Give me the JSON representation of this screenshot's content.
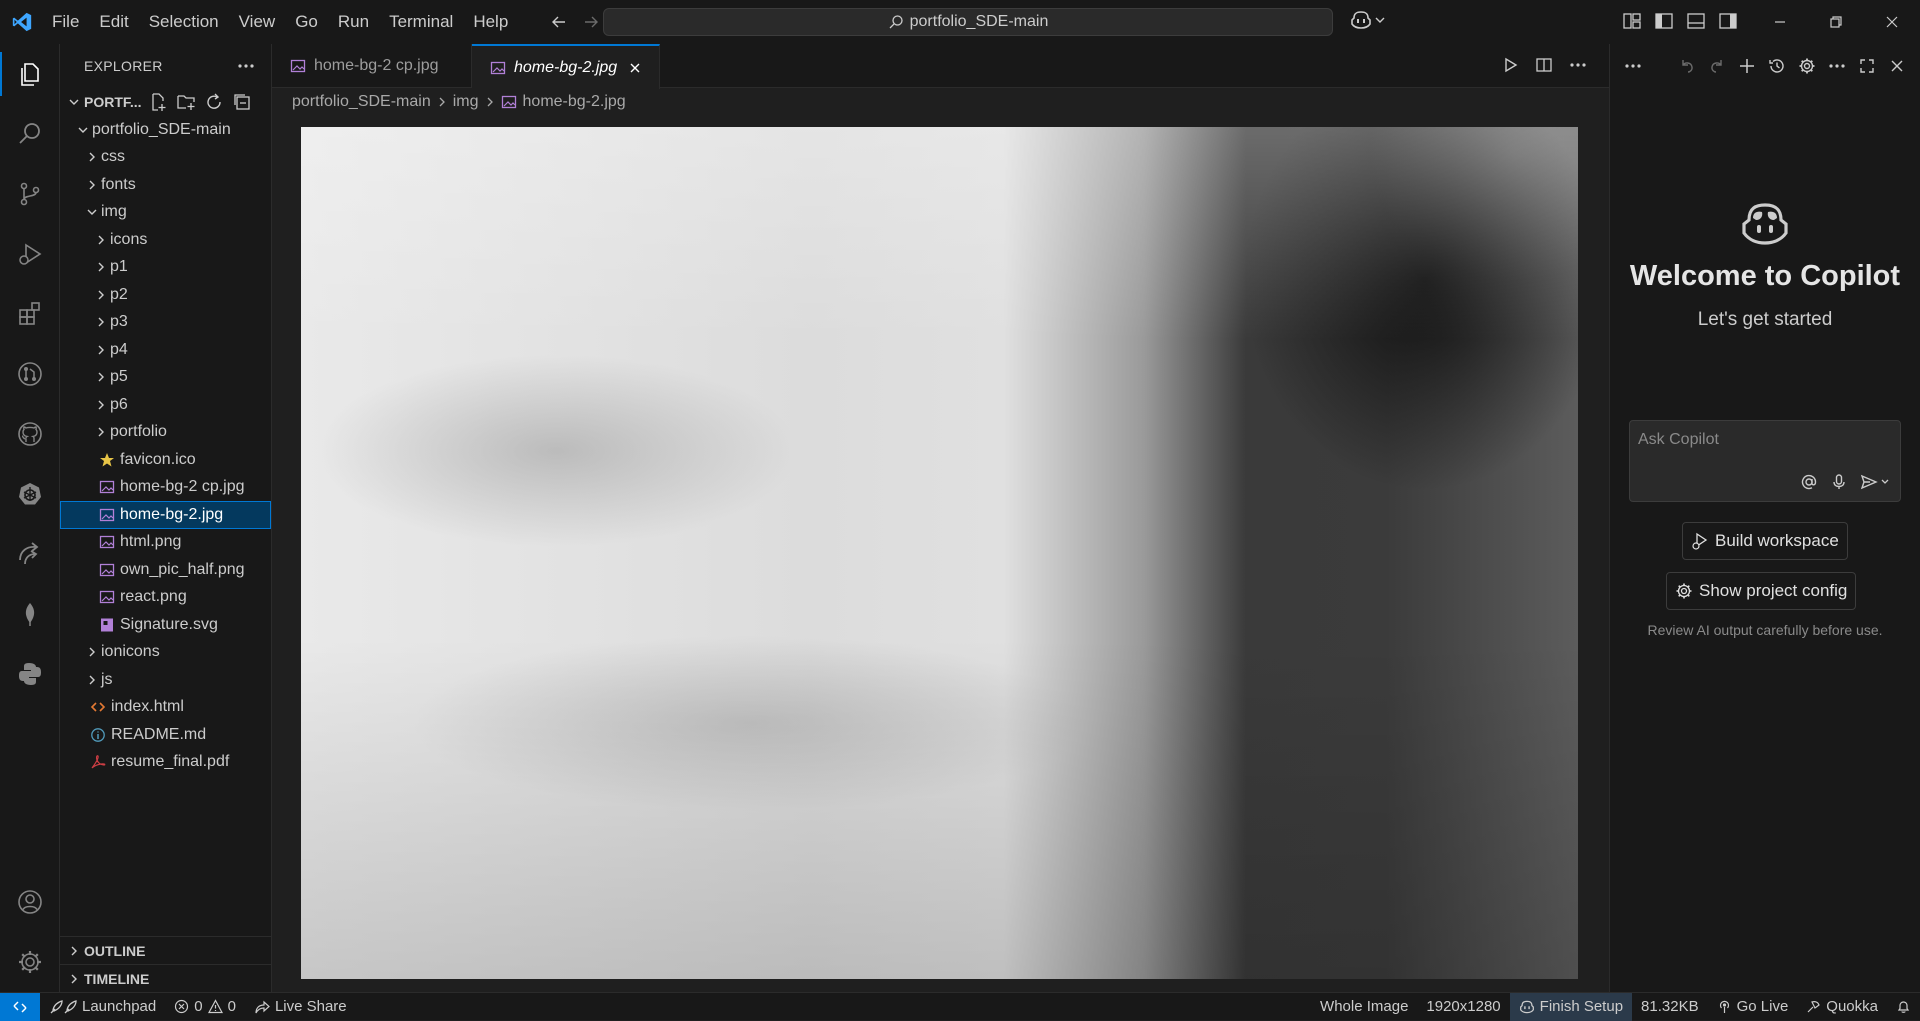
{
  "menu": [
    "File",
    "Edit",
    "Selection",
    "View",
    "Go",
    "Run",
    "Terminal",
    "Help"
  ],
  "search": {
    "text": "portfolio_SDE-main"
  },
  "sidebar": {
    "header": "EXPLORER",
    "section_title": "PORTF...",
    "tree": [
      {
        "label": "portfolio_SDE-main",
        "type": "folder-open",
        "depth": 0
      },
      {
        "label": "css",
        "type": "folder",
        "depth": 1
      },
      {
        "label": "fonts",
        "type": "folder",
        "depth": 1
      },
      {
        "label": "img",
        "type": "folder-open",
        "depth": 1
      },
      {
        "label": "icons",
        "type": "folder",
        "depth": 2
      },
      {
        "label": "p1",
        "type": "folder",
        "depth": 2
      },
      {
        "label": "p2",
        "type": "folder",
        "depth": 2
      },
      {
        "label": "p3",
        "type": "folder",
        "depth": 2
      },
      {
        "label": "p4",
        "type": "folder",
        "depth": 2
      },
      {
        "label": "p5",
        "type": "folder",
        "depth": 2
      },
      {
        "label": "p6",
        "type": "folder",
        "depth": 2
      },
      {
        "label": "portfolio",
        "type": "folder",
        "depth": 2
      },
      {
        "label": "favicon.ico",
        "type": "star-file",
        "depth": 2
      },
      {
        "label": "home-bg-2 cp.jpg",
        "type": "image-file",
        "depth": 2
      },
      {
        "label": "home-bg-2.jpg",
        "type": "image-file",
        "depth": 2,
        "selected": true
      },
      {
        "label": "html.png",
        "type": "image-file",
        "depth": 2
      },
      {
        "label": "own_pic_half.png",
        "type": "image-file",
        "depth": 2
      },
      {
        "label": "react.png",
        "type": "image-file",
        "depth": 2
      },
      {
        "label": "Signature.svg",
        "type": "svg-file",
        "depth": 2
      },
      {
        "label": "ionicons",
        "type": "folder",
        "depth": 1
      },
      {
        "label": "js",
        "type": "folder",
        "depth": 1
      },
      {
        "label": "index.html",
        "type": "html-file",
        "depth": 1
      },
      {
        "label": "README.md",
        "type": "info-file",
        "depth": 1
      },
      {
        "label": "resume_final.pdf",
        "type": "pdf-file",
        "depth": 1
      }
    ],
    "outline": "OUTLINE",
    "timeline": "TIMELINE"
  },
  "editor": {
    "tabs": [
      {
        "label": "home-bg-2 cp.jpg",
        "active": false
      },
      {
        "label": "home-bg-2.jpg",
        "active": true
      }
    ],
    "breadcrumb": [
      "portfolio_SDE-main",
      "img",
      "home-bg-2.jpg"
    ]
  },
  "copilot": {
    "title": "Welcome to Copilot",
    "subtitle": "Let's get started",
    "input_placeholder": "Ask Copilot",
    "build_workspace": "Build workspace",
    "show_project_config": "Show project config",
    "note": "Review AI output carefully before use."
  },
  "statusbar": {
    "launchpad": "Launchpad",
    "errors": "0",
    "warnings": "0",
    "live_share": "Live Share",
    "zoom": "Whole Image",
    "dimensions": "1920x1280",
    "finish_setup": "Finish Setup",
    "file_size": "81.32KB",
    "go_live": "Go Live",
    "quokka": "Quokka"
  },
  "colors": {
    "accent": "#0078d4",
    "background": "#1f1f1f",
    "sidebar": "#181818"
  }
}
